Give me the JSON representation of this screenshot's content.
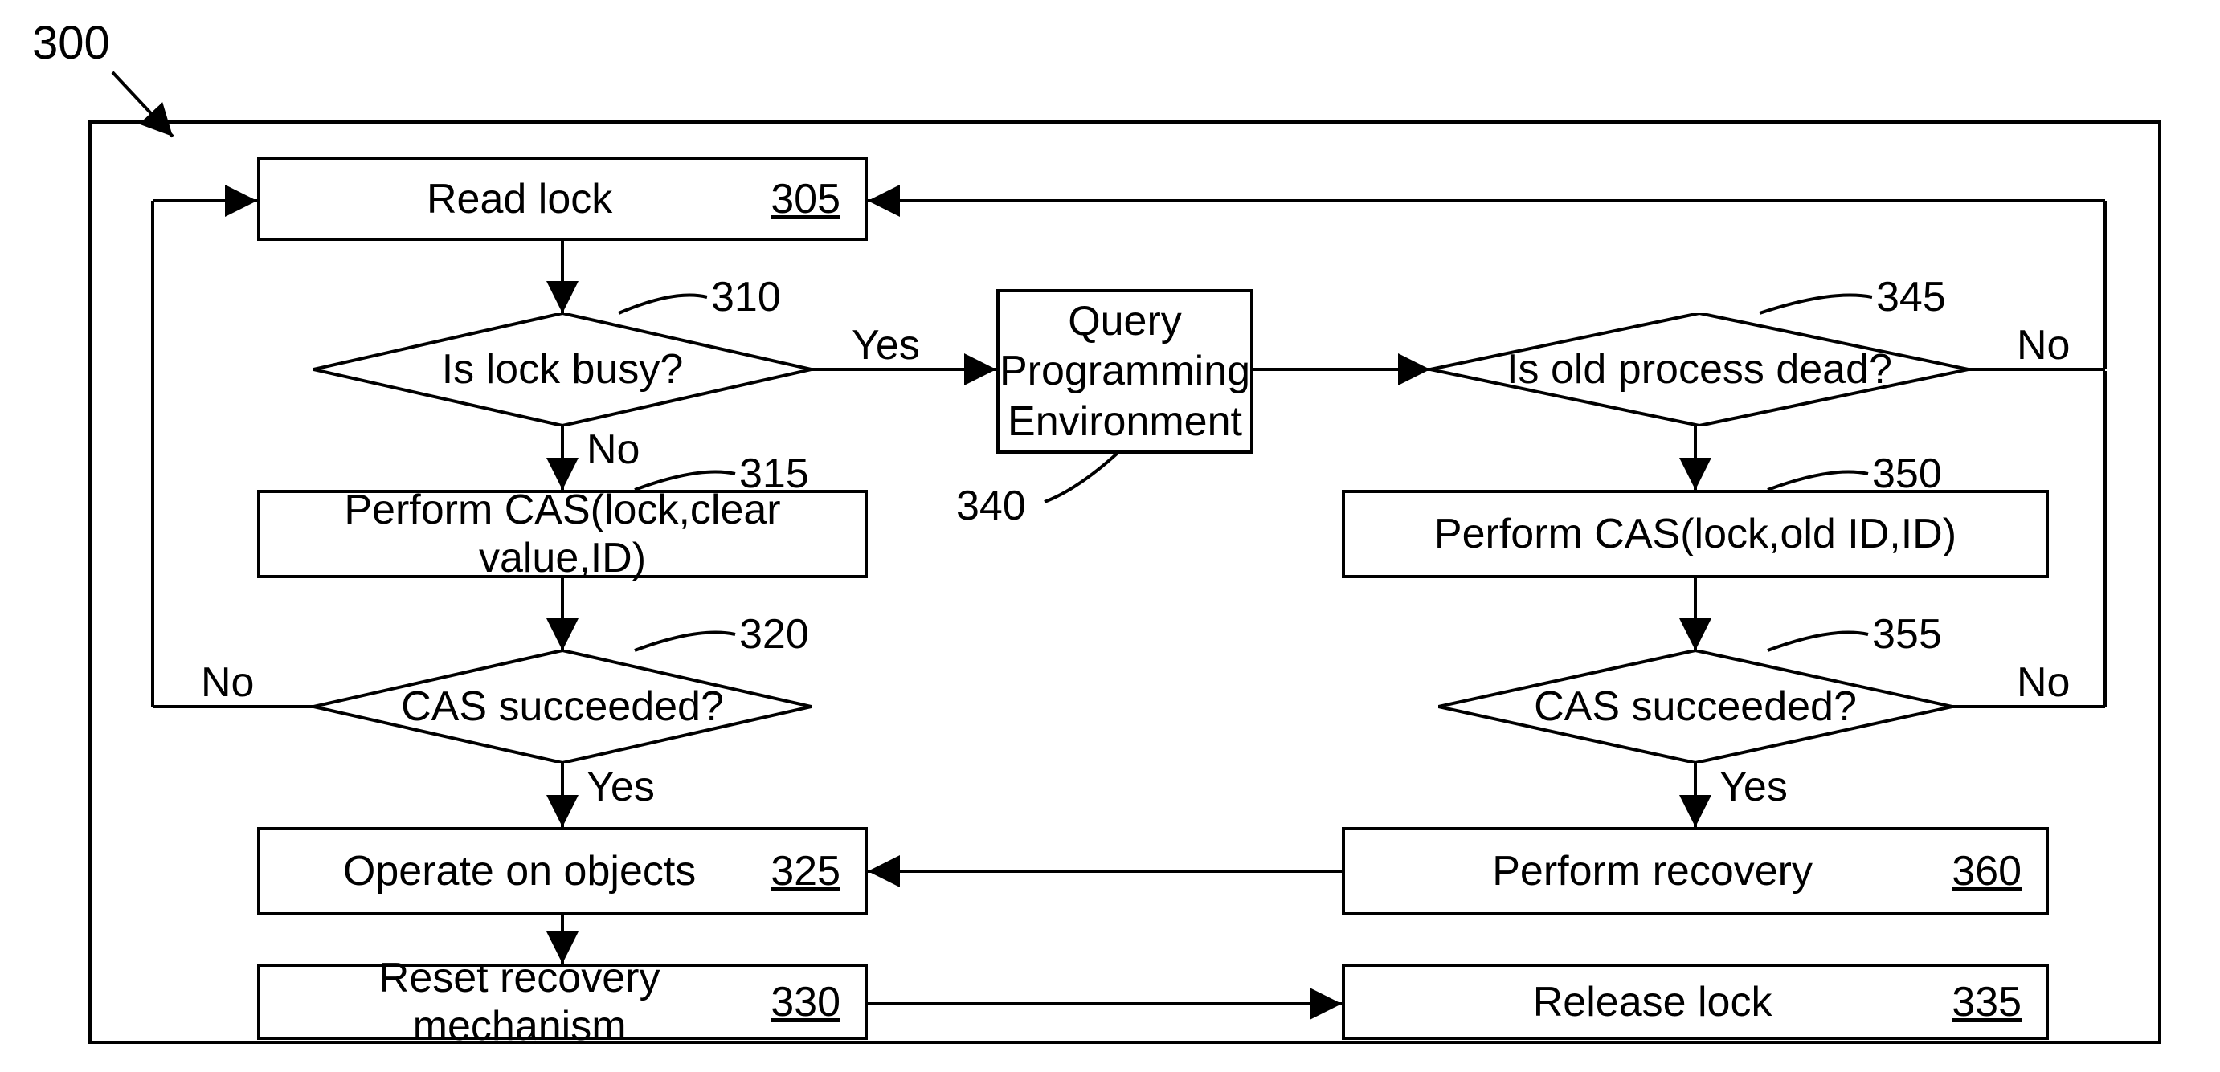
{
  "figure": {
    "number": "300"
  },
  "nodes": {
    "n305": {
      "text": "Read lock",
      "ref": "305"
    },
    "n310": {
      "text": "Is lock busy?",
      "ref": "310"
    },
    "n315": {
      "text": "Perform CAS(lock,clear value,ID)",
      "ref": "315"
    },
    "n320": {
      "text": "CAS succeeded?",
      "ref": "320"
    },
    "n325": {
      "text": "Operate on objects",
      "ref": "325"
    },
    "n330": {
      "text": "Reset recovery mechanism",
      "ref": "330"
    },
    "n335": {
      "text": "Release lock",
      "ref": "335"
    },
    "n340": {
      "text": "Query Programming Environment",
      "ref": "340"
    },
    "n345": {
      "text": "Is old process dead?",
      "ref": "345"
    },
    "n350": {
      "text": "Perform CAS(lock,old ID,ID)",
      "ref": "350"
    },
    "n355": {
      "text": "CAS succeeded?",
      "ref": "355"
    },
    "n360": {
      "text": "Perform recovery",
      "ref": "360"
    }
  },
  "labels": {
    "yes": "Yes",
    "no": "No"
  }
}
